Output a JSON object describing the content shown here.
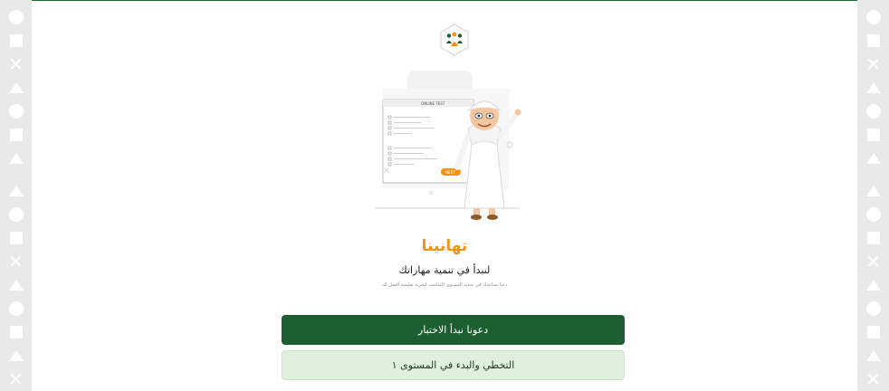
{
  "colors": {
    "brand_green": "#1c5e30",
    "accent_orange": "#f2941a",
    "secondary_bg": "#dff0dc"
  },
  "logo": {
    "icon": "people-group-icon"
  },
  "illustration": {
    "icon": "online-test-character-illustration",
    "sheet_title": "ONLINE TEST",
    "sheet_button": "NEXT"
  },
  "main": {
    "title": "تهانينا",
    "subtitle": "لنبدأ في تنمية مهاراتك",
    "note": "دعنا نساعدك في تحديد المستوى المناسب لتجربة تعليمية أفضل لك"
  },
  "actions": {
    "start_test_label": "دعونا نبدأ الاختبار",
    "skip_label": "التخطي والبدء في المستوى ١"
  }
}
